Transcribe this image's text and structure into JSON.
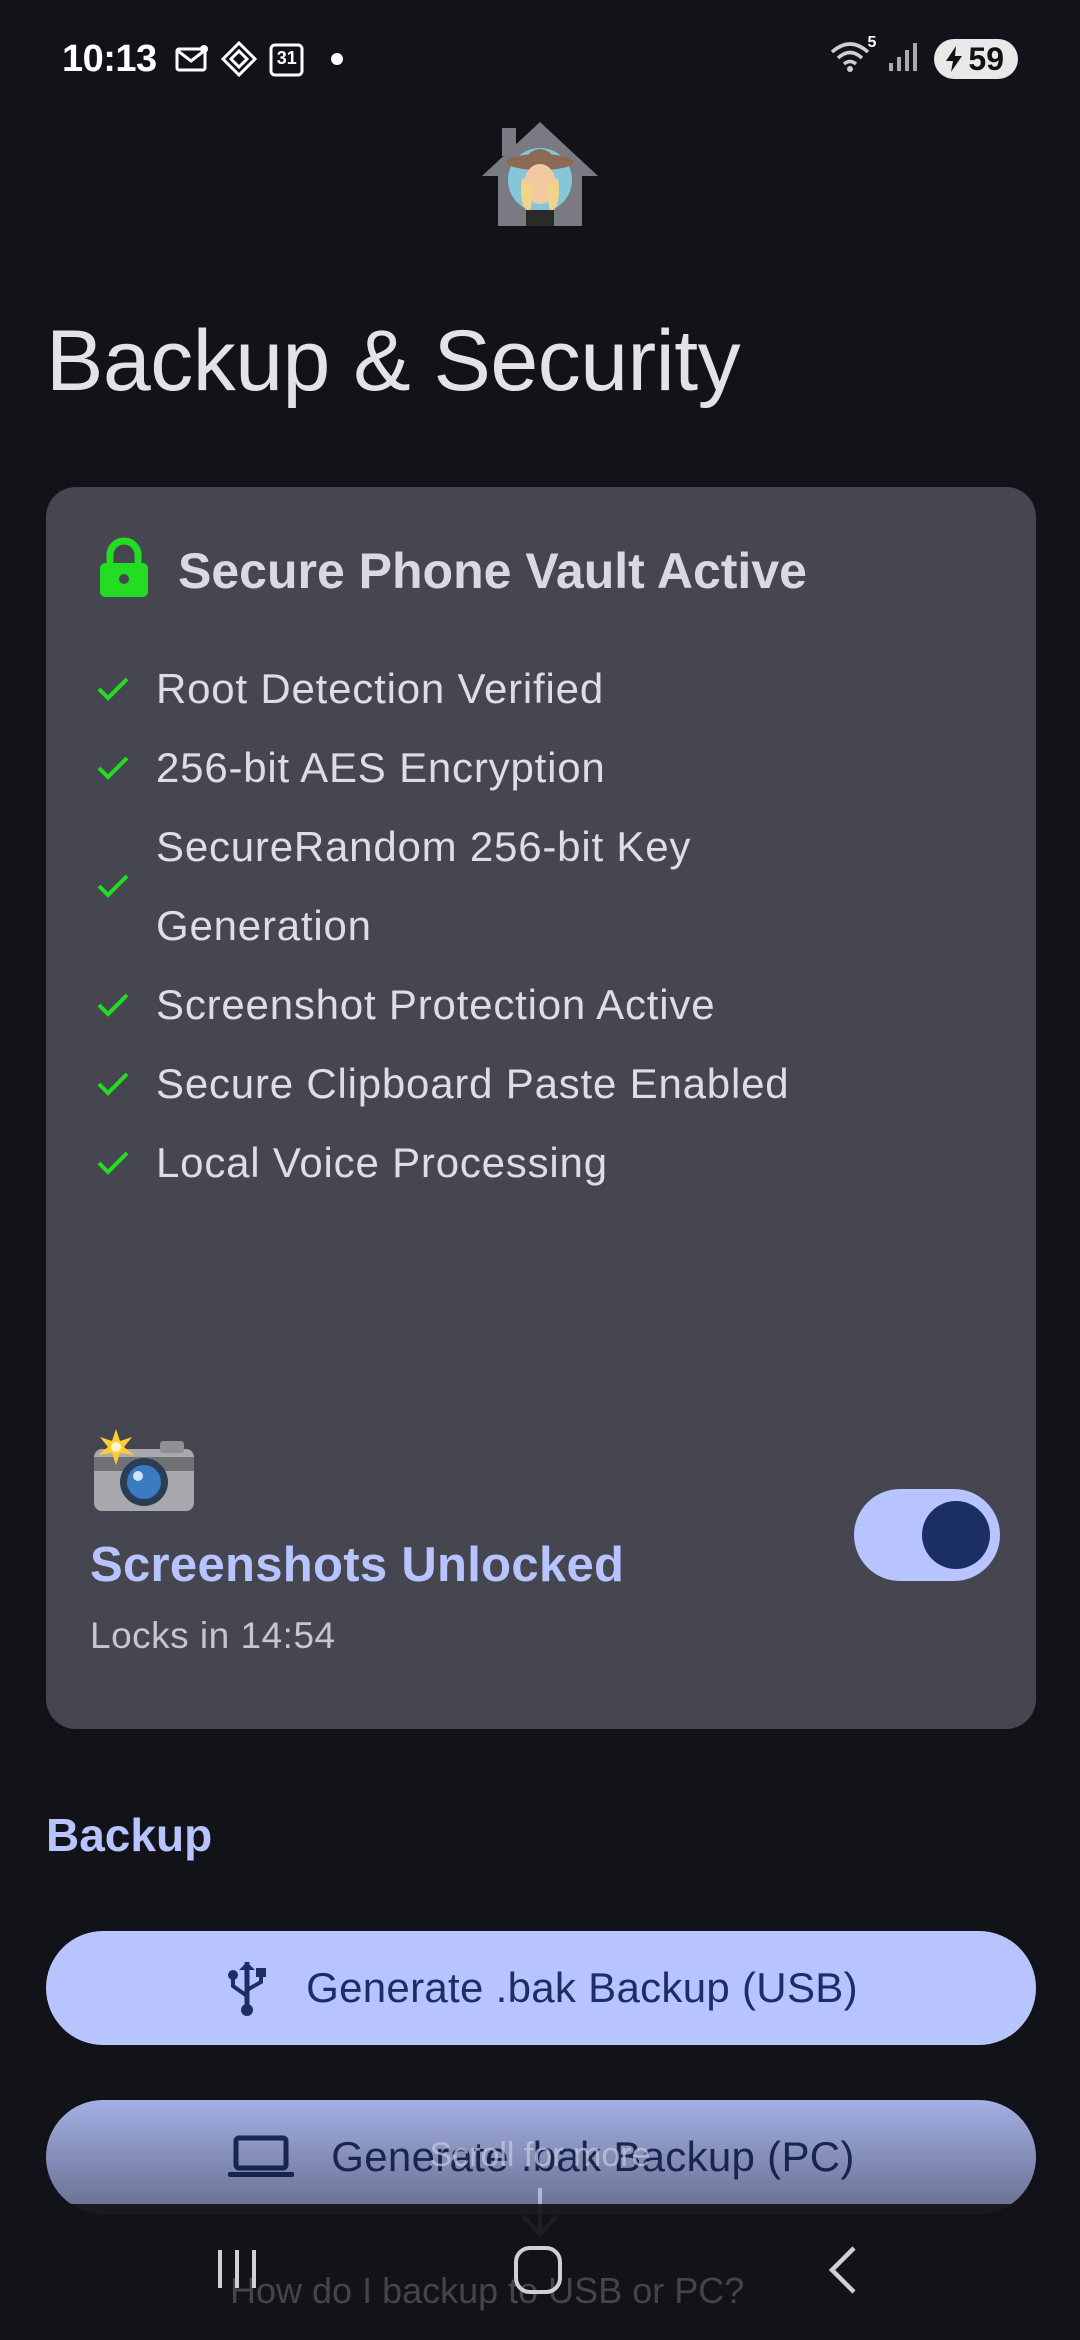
{
  "status_bar": {
    "time": "10:13",
    "calendar_day": "31",
    "wifi_badge": "5",
    "battery": "59"
  },
  "header": {
    "title": "Backup & Security"
  },
  "vault": {
    "title": "Secure Phone Vault Active",
    "features": [
      {
        "label": "Root Detection Verified"
      },
      {
        "label": "256-bit AES Encryption"
      },
      {
        "label": "SecureRandom 256-bit Key Generation"
      },
      {
        "label": "Screenshot Protection Active"
      },
      {
        "label": "Secure Clipboard Paste Enabled"
      },
      {
        "label": "Local Voice Processing"
      }
    ],
    "screenshots": {
      "title": "Screenshots Unlocked",
      "subtitle": "Locks in 14:54",
      "toggle_on": true
    }
  },
  "backup": {
    "section_label": "Backup",
    "usb_button": "Generate .bak Backup (USB)",
    "pc_button": "Generate .bak Backup (PC)",
    "scroll_hint": "Scroll for more",
    "faq_peek": "How do I backup to USB or PC?"
  },
  "colors": {
    "background": "#121318",
    "card": "#454650",
    "accent": "#b8c4ff",
    "accent_on": "#1b2f66",
    "check_green": "#22dd22"
  }
}
